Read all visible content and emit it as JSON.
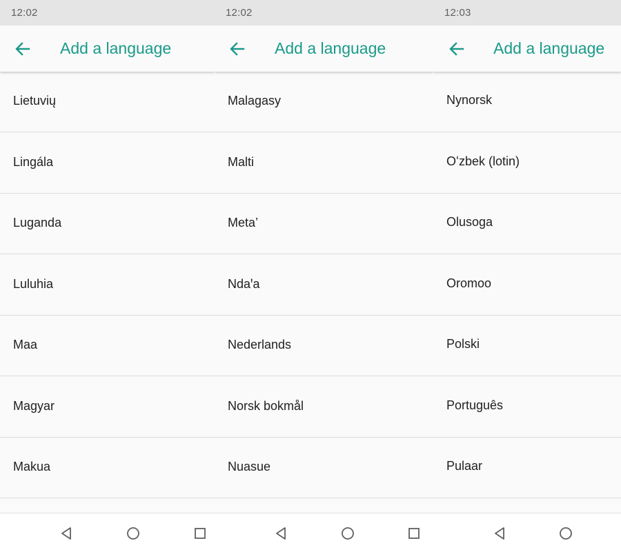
{
  "colors": {
    "accent": "#1a9a8a",
    "status_bar": "#e5e5e5",
    "background": "#fafafa",
    "divider": "#dcdcdc",
    "nav_icon": "#5f5f5f"
  },
  "panels": [
    {
      "status": {
        "time": "12:02"
      },
      "app_bar": {
        "back_icon": "arrow-left-icon",
        "title": "Add a language"
      },
      "items": [
        "Lietuvių",
        "Lingála",
        "Luganda",
        "Luluhia",
        "Maa",
        "Magyar",
        "Makua"
      ],
      "nav": {
        "back_icon": "triangle-back-icon",
        "home_icon": "circle-home-icon",
        "recents_icon": "square-recents-icon"
      }
    },
    {
      "status": {
        "time": "12:02"
      },
      "app_bar": {
        "back_icon": "arrow-left-icon",
        "title": "Add a language"
      },
      "items": [
        "Malagasy",
        "Malti",
        "Meta’",
        "Ndaꞌa",
        "Nederlands",
        "Norsk bokmål",
        "Nuasue"
      ],
      "nav": {
        "back_icon": "triangle-back-icon",
        "home_icon": "circle-home-icon",
        "recents_icon": "square-recents-icon"
      }
    },
    {
      "status": {
        "time": "12:03"
      },
      "app_bar": {
        "back_icon": "arrow-left-icon",
        "title": "Add a language"
      },
      "items": [
        "Nynorsk",
        "Oʻzbek (lotin)",
        "Olusoga",
        "Oromoo",
        "Polski",
        "Português",
        "Pulaar"
      ],
      "nav": {
        "back_icon": "triangle-back-icon",
        "home_icon": "circle-home-icon"
      }
    }
  ]
}
